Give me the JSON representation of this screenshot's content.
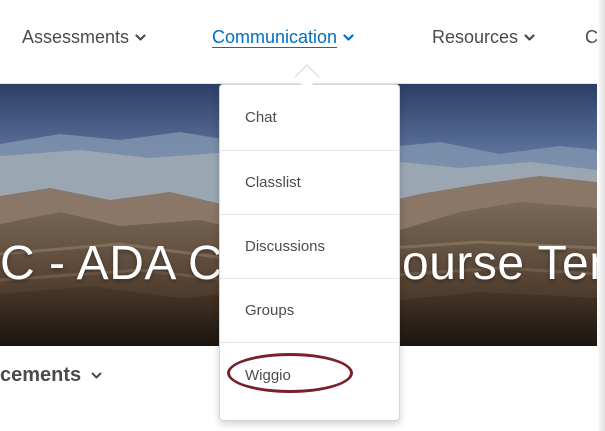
{
  "nav": {
    "items": [
      {
        "label": "Assessments",
        "active": false
      },
      {
        "label": "Communication",
        "active": true
      },
      {
        "label": "Resources",
        "active": false
      },
      {
        "label": "C",
        "active": false
      }
    ]
  },
  "banner": {
    "title": "C - ADA C",
    "title_right": "ourse Tem"
  },
  "dropdown": {
    "items": [
      {
        "label": "Chat"
      },
      {
        "label": "Classlist"
      },
      {
        "label": "Discussions"
      },
      {
        "label": "Groups"
      },
      {
        "label": "Wiggio",
        "highlighted": true
      }
    ]
  },
  "widget": {
    "title": "cements"
  },
  "colors": {
    "active_link": "#006fbf",
    "text": "#494c4e",
    "highlight_ring": "#7a1f2b"
  }
}
